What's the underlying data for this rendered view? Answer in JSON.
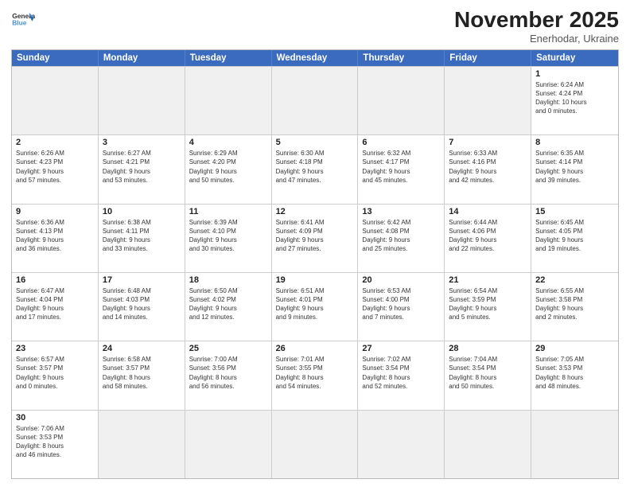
{
  "logo": {
    "text_general": "General",
    "text_blue": "Blue"
  },
  "title": "November 2025",
  "subtitle": "Enerhodar, Ukraine",
  "header_days": [
    "Sunday",
    "Monday",
    "Tuesday",
    "Wednesday",
    "Thursday",
    "Friday",
    "Saturday"
  ],
  "weeks": [
    [
      {
        "day": "",
        "empty": true
      },
      {
        "day": "",
        "empty": true
      },
      {
        "day": "",
        "empty": true
      },
      {
        "day": "",
        "empty": true
      },
      {
        "day": "",
        "empty": true
      },
      {
        "day": "",
        "empty": true
      },
      {
        "day": "1",
        "info": "Sunrise: 6:24 AM\nSunset: 4:24 PM\nDaylight: 10 hours\nand 0 minutes."
      }
    ],
    [
      {
        "day": "2",
        "info": "Sunrise: 6:26 AM\nSunset: 4:23 PM\nDaylight: 9 hours\nand 57 minutes."
      },
      {
        "day": "3",
        "info": "Sunrise: 6:27 AM\nSunset: 4:21 PM\nDaylight: 9 hours\nand 53 minutes."
      },
      {
        "day": "4",
        "info": "Sunrise: 6:29 AM\nSunset: 4:20 PM\nDaylight: 9 hours\nand 50 minutes."
      },
      {
        "day": "5",
        "info": "Sunrise: 6:30 AM\nSunset: 4:18 PM\nDaylight: 9 hours\nand 47 minutes."
      },
      {
        "day": "6",
        "info": "Sunrise: 6:32 AM\nSunset: 4:17 PM\nDaylight: 9 hours\nand 45 minutes."
      },
      {
        "day": "7",
        "info": "Sunrise: 6:33 AM\nSunset: 4:16 PM\nDaylight: 9 hours\nand 42 minutes."
      },
      {
        "day": "8",
        "info": "Sunrise: 6:35 AM\nSunset: 4:14 PM\nDaylight: 9 hours\nand 39 minutes."
      }
    ],
    [
      {
        "day": "9",
        "info": "Sunrise: 6:36 AM\nSunset: 4:13 PM\nDaylight: 9 hours\nand 36 minutes."
      },
      {
        "day": "10",
        "info": "Sunrise: 6:38 AM\nSunset: 4:11 PM\nDaylight: 9 hours\nand 33 minutes."
      },
      {
        "day": "11",
        "info": "Sunrise: 6:39 AM\nSunset: 4:10 PM\nDaylight: 9 hours\nand 30 minutes."
      },
      {
        "day": "12",
        "info": "Sunrise: 6:41 AM\nSunset: 4:09 PM\nDaylight: 9 hours\nand 27 minutes."
      },
      {
        "day": "13",
        "info": "Sunrise: 6:42 AM\nSunset: 4:08 PM\nDaylight: 9 hours\nand 25 minutes."
      },
      {
        "day": "14",
        "info": "Sunrise: 6:44 AM\nSunset: 4:06 PM\nDaylight: 9 hours\nand 22 minutes."
      },
      {
        "day": "15",
        "info": "Sunrise: 6:45 AM\nSunset: 4:05 PM\nDaylight: 9 hours\nand 19 minutes."
      }
    ],
    [
      {
        "day": "16",
        "info": "Sunrise: 6:47 AM\nSunset: 4:04 PM\nDaylight: 9 hours\nand 17 minutes."
      },
      {
        "day": "17",
        "info": "Sunrise: 6:48 AM\nSunset: 4:03 PM\nDaylight: 9 hours\nand 14 minutes."
      },
      {
        "day": "18",
        "info": "Sunrise: 6:50 AM\nSunset: 4:02 PM\nDaylight: 9 hours\nand 12 minutes."
      },
      {
        "day": "19",
        "info": "Sunrise: 6:51 AM\nSunset: 4:01 PM\nDaylight: 9 hours\nand 9 minutes."
      },
      {
        "day": "20",
        "info": "Sunrise: 6:53 AM\nSunset: 4:00 PM\nDaylight: 9 hours\nand 7 minutes."
      },
      {
        "day": "21",
        "info": "Sunrise: 6:54 AM\nSunset: 3:59 PM\nDaylight: 9 hours\nand 5 minutes."
      },
      {
        "day": "22",
        "info": "Sunrise: 6:55 AM\nSunset: 3:58 PM\nDaylight: 9 hours\nand 2 minutes."
      }
    ],
    [
      {
        "day": "23",
        "info": "Sunrise: 6:57 AM\nSunset: 3:57 PM\nDaylight: 9 hours\nand 0 minutes."
      },
      {
        "day": "24",
        "info": "Sunrise: 6:58 AM\nSunset: 3:57 PM\nDaylight: 8 hours\nand 58 minutes."
      },
      {
        "day": "25",
        "info": "Sunrise: 7:00 AM\nSunset: 3:56 PM\nDaylight: 8 hours\nand 56 minutes."
      },
      {
        "day": "26",
        "info": "Sunrise: 7:01 AM\nSunset: 3:55 PM\nDaylight: 8 hours\nand 54 minutes."
      },
      {
        "day": "27",
        "info": "Sunrise: 7:02 AM\nSunset: 3:54 PM\nDaylight: 8 hours\nand 52 minutes."
      },
      {
        "day": "28",
        "info": "Sunrise: 7:04 AM\nSunset: 3:54 PM\nDaylight: 8 hours\nand 50 minutes."
      },
      {
        "day": "29",
        "info": "Sunrise: 7:05 AM\nSunset: 3:53 PM\nDaylight: 8 hours\nand 48 minutes."
      }
    ],
    [
      {
        "day": "30",
        "info": "Sunrise: 7:06 AM\nSunset: 3:53 PM\nDaylight: 8 hours\nand 46 minutes."
      },
      {
        "day": "",
        "empty": true
      },
      {
        "day": "",
        "empty": true
      },
      {
        "day": "",
        "empty": true
      },
      {
        "day": "",
        "empty": true
      },
      {
        "day": "",
        "empty": true
      },
      {
        "day": "",
        "empty": true
      }
    ]
  ]
}
